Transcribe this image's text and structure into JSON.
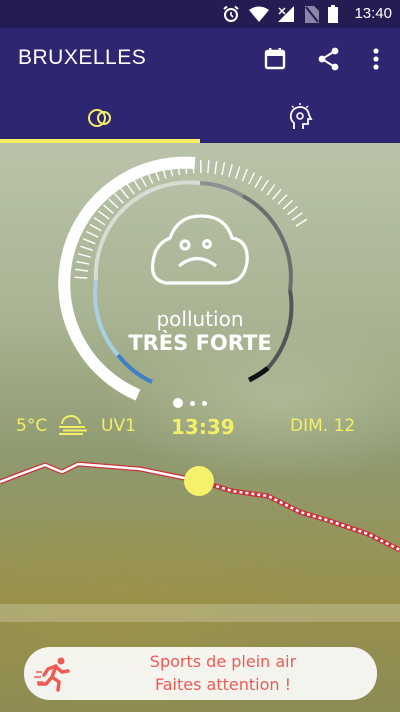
{
  "status_bar": {
    "time": "13:40"
  },
  "app_bar": {
    "title": "BRUXELLES"
  },
  "tabs": [
    {
      "icon": "cloud-ring-icon",
      "selected": true
    },
    {
      "icon": "head-idea-icon",
      "selected": false
    }
  ],
  "gauge": {
    "label": "pollution",
    "level": "TRÈS FORTE"
  },
  "pager": {
    "pages": 3,
    "current": 1
  },
  "weather": {
    "temperature": "5°C",
    "condition_icon": "fog-sun-icon",
    "uv": "UV1",
    "time": "13:39",
    "day": "DIM. 12"
  },
  "colors": {
    "primary": "#2e2670",
    "status_bar": "#241c52",
    "accent": "#f3ef67",
    "alert_text": "#f05a55"
  },
  "alert": {
    "icon": "runner-icon",
    "line1": "Sports de plein air",
    "line2": "Faites attention !"
  }
}
